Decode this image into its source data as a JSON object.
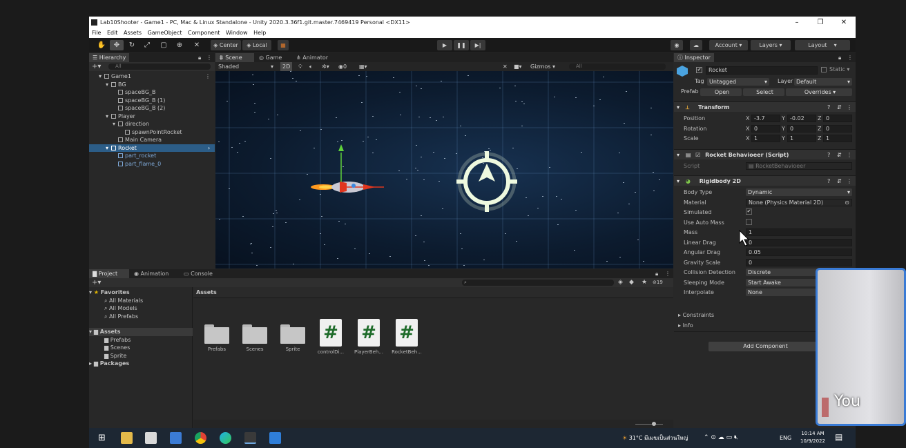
{
  "window": {
    "title": "Lab10Shooter - Game1 - PC, Mac & Linux Standalone - Unity 2020.3.36f1.git.master.7469419 Personal <DX11>",
    "controls": [
      "–",
      "❐",
      "✕"
    ]
  },
  "menu": [
    "File",
    "Edit",
    "Assets",
    "GameObject",
    "Component",
    "Window",
    "Help"
  ],
  "toolbar": {
    "pivot": "Center",
    "space": "Local",
    "account": "Account",
    "layers": "Layers",
    "layout": "Layout"
  },
  "hierarchy": {
    "tab": "Hierarchy",
    "search_placeholder": "All",
    "rows": [
      {
        "label": "Game1",
        "indent": 1,
        "type": "scene"
      },
      {
        "label": "BG",
        "indent": 2,
        "type": "go"
      },
      {
        "label": "spaceBG_B",
        "indent": 3,
        "type": "go"
      },
      {
        "label": "spaceBG_B (1)",
        "indent": 3,
        "type": "go"
      },
      {
        "label": "spaceBG_B (2)",
        "indent": 3,
        "type": "go"
      },
      {
        "label": "Player",
        "indent": 2,
        "type": "go"
      },
      {
        "label": "direction",
        "indent": 3,
        "type": "go"
      },
      {
        "label": "spawnPointRocket",
        "indent": 4,
        "type": "go"
      },
      {
        "label": "Main Camera",
        "indent": 3,
        "type": "go"
      },
      {
        "label": "Rocket",
        "indent": 2,
        "type": "prefab",
        "selected": true
      },
      {
        "label": "part_rocket",
        "indent": 3,
        "type": "prefab"
      },
      {
        "label": "part_flame_0",
        "indent": 3,
        "type": "prefab"
      }
    ]
  },
  "scene": {
    "tabs": [
      "Scene",
      "Game",
      "Animator"
    ],
    "shading": "Shaded",
    "mode2d": "2D",
    "layers_count": "0",
    "gizmos": "Gizmos",
    "search_placeholder": "All"
  },
  "inspector": {
    "tab": "Inspector",
    "object_name": "Rocket",
    "static_label": "Static",
    "tag_label": "Tag",
    "tag_value": "Untagged",
    "layer_label": "Layer",
    "layer_value": "Default",
    "prefab_label": "Prefab",
    "prefab_open": "Open",
    "prefab_select": "Select",
    "prefab_overrides": "Overrides",
    "transform": {
      "title": "Transform",
      "position_label": "Position",
      "rotation_label": "Rotation",
      "scale_label": "Scale",
      "position": {
        "x": "-3.7",
        "y": "-0.02",
        "z": "0"
      },
      "rotation": {
        "x": "0",
        "y": "0",
        "z": "0"
      },
      "scale": {
        "x": "1",
        "y": "1",
        "z": "1"
      }
    },
    "script_component": {
      "title": "Rocket Behavioeer (Script)",
      "script_label": "Script",
      "script_value": "RocketBehavioeer"
    },
    "rigidbody": {
      "title": "Rigidbody 2D",
      "rows": [
        {
          "label": "Body Type",
          "value": "Dynamic",
          "kind": "dropdown"
        },
        {
          "label": "Material",
          "value": "None (Physics Material 2D)",
          "kind": "object"
        },
        {
          "label": "Simulated",
          "value": "✔",
          "kind": "check"
        },
        {
          "label": "Use Auto Mass",
          "value": "",
          "kind": "check"
        },
        {
          "label": "Mass",
          "value": "1",
          "kind": "field"
        },
        {
          "label": "Linear Drag",
          "value": "0",
          "kind": "field"
        },
        {
          "label": "Angular Drag",
          "value": "0.05",
          "kind": "field"
        },
        {
          "label": "Gravity Scale",
          "value": "0",
          "kind": "field"
        },
        {
          "label": "Collision Detection",
          "value": "Discrete",
          "kind": "dropdown"
        },
        {
          "label": "Sleeping Mode",
          "value": "Start Awake",
          "kind": "dropdown"
        },
        {
          "label": "Interpolate",
          "value": "None",
          "kind": "dropdown"
        }
      ],
      "constraints": "Constraints",
      "info": "Info"
    },
    "add_component": "Add Component"
  },
  "project": {
    "tabs": [
      "Project",
      "Animation",
      "Console"
    ],
    "favorites": "Favorites",
    "favorite_items": [
      "All Materials",
      "All Models",
      "All Prefabs"
    ],
    "assets_root": "Assets",
    "asset_folders": [
      "Prefabs",
      "Scenes",
      "Sprite"
    ],
    "packages": "Packages",
    "breadcrumb": "Assets",
    "hidden_count": "19",
    "grid_items": [
      {
        "label": "Prefabs",
        "kind": "folder"
      },
      {
        "label": "Scenes",
        "kind": "folder"
      },
      {
        "label": "Sprite",
        "kind": "folder"
      },
      {
        "label": "controlDi...",
        "kind": "script"
      },
      {
        "label": "PlayerBeh...",
        "kind": "script"
      },
      {
        "label": "RocketBeh...",
        "kind": "script"
      }
    ]
  },
  "taskbar": {
    "weather": "31°C  มีเมฆเป็นส่วนใหญ่",
    "lang": "ENG",
    "time": "10:14 AM",
    "date": "10/9/2022"
  },
  "video_overlay": {
    "label": "You"
  }
}
